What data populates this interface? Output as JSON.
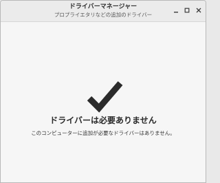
{
  "window": {
    "title": "ドライバーマネージャー",
    "subtitle": "プロプライエタリなどの追加のドライバー",
    "controls": {
      "minimize_icon": "minimize-icon",
      "maximize_icon": "maximize-icon",
      "close_icon": "close-icon"
    }
  },
  "main": {
    "status_icon": "checkmark-icon",
    "headline": "ドライバーは必要ありません",
    "message": "このコンピューターに追加が必要なドライバーはありません。"
  },
  "colors": {
    "titlebar": "#ebebeb",
    "content_background": "#f6f6f6",
    "checkmark": "#2b2b2b",
    "text": "#2a2a2a"
  }
}
